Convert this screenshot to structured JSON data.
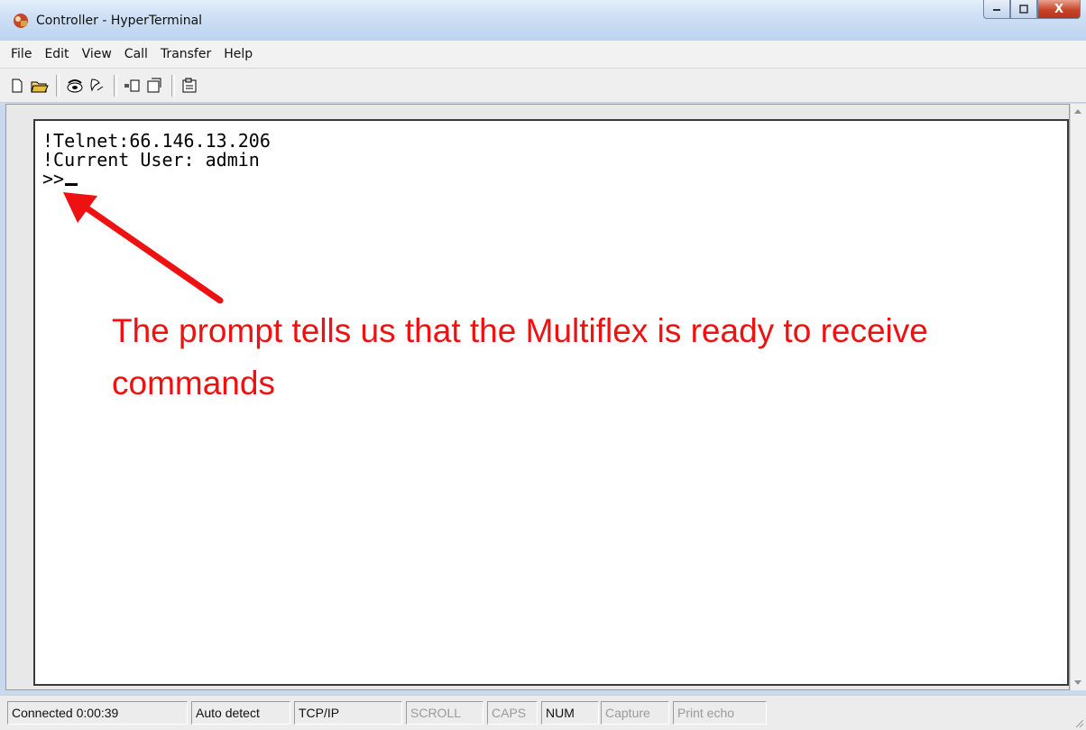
{
  "window": {
    "title": "Controller - HyperTerminal",
    "close_glyph": "X",
    "caption_icons": [
      "minimize-icon",
      "maximize-icon",
      "close-icon"
    ]
  },
  "menu": [
    "File",
    "Edit",
    "View",
    "Call",
    "Transfer",
    "Help"
  ],
  "toolbar_icons": [
    "new-file-icon",
    "open-folder-icon",
    "call-icon",
    "disconnect-icon",
    "send-icon",
    "receive-icon",
    "properties-icon"
  ],
  "terminal": {
    "line1": "!Telnet:66.146.13.206",
    "line2": "!Current User: admin",
    "prompt": ">>"
  },
  "annotation": {
    "text": "The prompt tells us that the Multiflex is ready to receive commands",
    "color": "#ee1111"
  },
  "status": {
    "connected": "Connected 0:00:39",
    "detect": "Auto detect",
    "protocol": "TCP/IP",
    "scroll": "SCROLL",
    "caps": "CAPS",
    "num": "NUM",
    "capture": "Capture",
    "print_echo": "Print echo"
  }
}
